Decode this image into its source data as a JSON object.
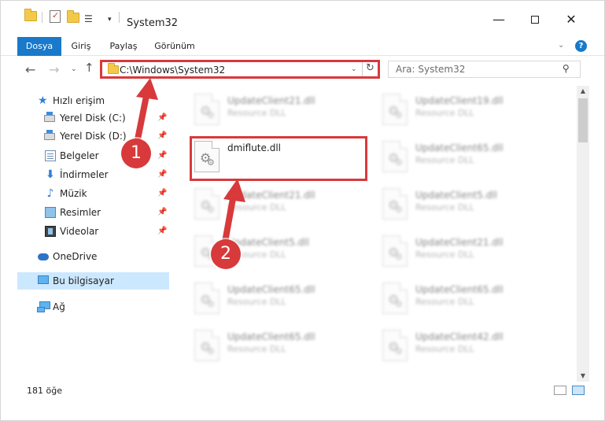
{
  "window": {
    "title": "System32",
    "controls": {
      "minimize": "—",
      "close": "✕"
    }
  },
  "ribbon": {
    "tabs": [
      {
        "label": "Dosya"
      },
      {
        "label": "Giriş"
      },
      {
        "label": "Paylaş"
      },
      {
        "label": "Görünüm"
      }
    ],
    "help": "?"
  },
  "navigation": {
    "back": "←",
    "forward": "→",
    "recent": "⌄",
    "up": "↑"
  },
  "address": {
    "path": "C:\\Windows\\System32",
    "refresh": "↻"
  },
  "search": {
    "placeholder": "Ara: System32",
    "icon": "⚲"
  },
  "sidebar": {
    "items": [
      {
        "label": "Hızlı erişim"
      },
      {
        "label": "Yerel Disk (C:)"
      },
      {
        "label": "Yerel Disk (D:)"
      },
      {
        "label": "Belgeler"
      },
      {
        "label": "İndirmeler"
      },
      {
        "label": "Müzik"
      },
      {
        "label": "Resimler"
      },
      {
        "label": "Videolar"
      },
      {
        "label": "OneDrive"
      },
      {
        "label": "Bu bilgisayar"
      },
      {
        "label": "Ağ"
      }
    ],
    "pin_glyph": "📌"
  },
  "files": {
    "left": [
      {
        "name": "UpdateClient21.dll",
        "desc": "Resource DLL"
      },
      {
        "name": "dmiflute.dll",
        "desc": ""
      },
      {
        "name": "UpdateClient21.dll",
        "desc": "Resource DLL"
      },
      {
        "name": "UpdateClient5.dll",
        "desc": "Resource DLL"
      },
      {
        "name": "UpdateClient65.dll",
        "desc": "Resource DLL"
      },
      {
        "name": "UpdateClient65.dll",
        "desc": "Resource DLL"
      }
    ],
    "right": [
      {
        "name": "UpdateClient19.dll",
        "desc": "Resource DLL"
      },
      {
        "name": "UpdateClient65.dll",
        "desc": "Resource DLL"
      },
      {
        "name": "UpdateClient5.dll",
        "desc": "Resource DLL"
      },
      {
        "name": "UpdateClient21.dll",
        "desc": "Resource DLL"
      },
      {
        "name": "UpdateClient65.dll",
        "desc": "Resource DLL"
      },
      {
        "name": "UpdateClient42.dll",
        "desc": "Resource DLL"
      }
    ]
  },
  "status": {
    "count": "181 öğe"
  },
  "annotations": {
    "step1": "1",
    "step2": "2",
    "color": "#d8393a"
  }
}
